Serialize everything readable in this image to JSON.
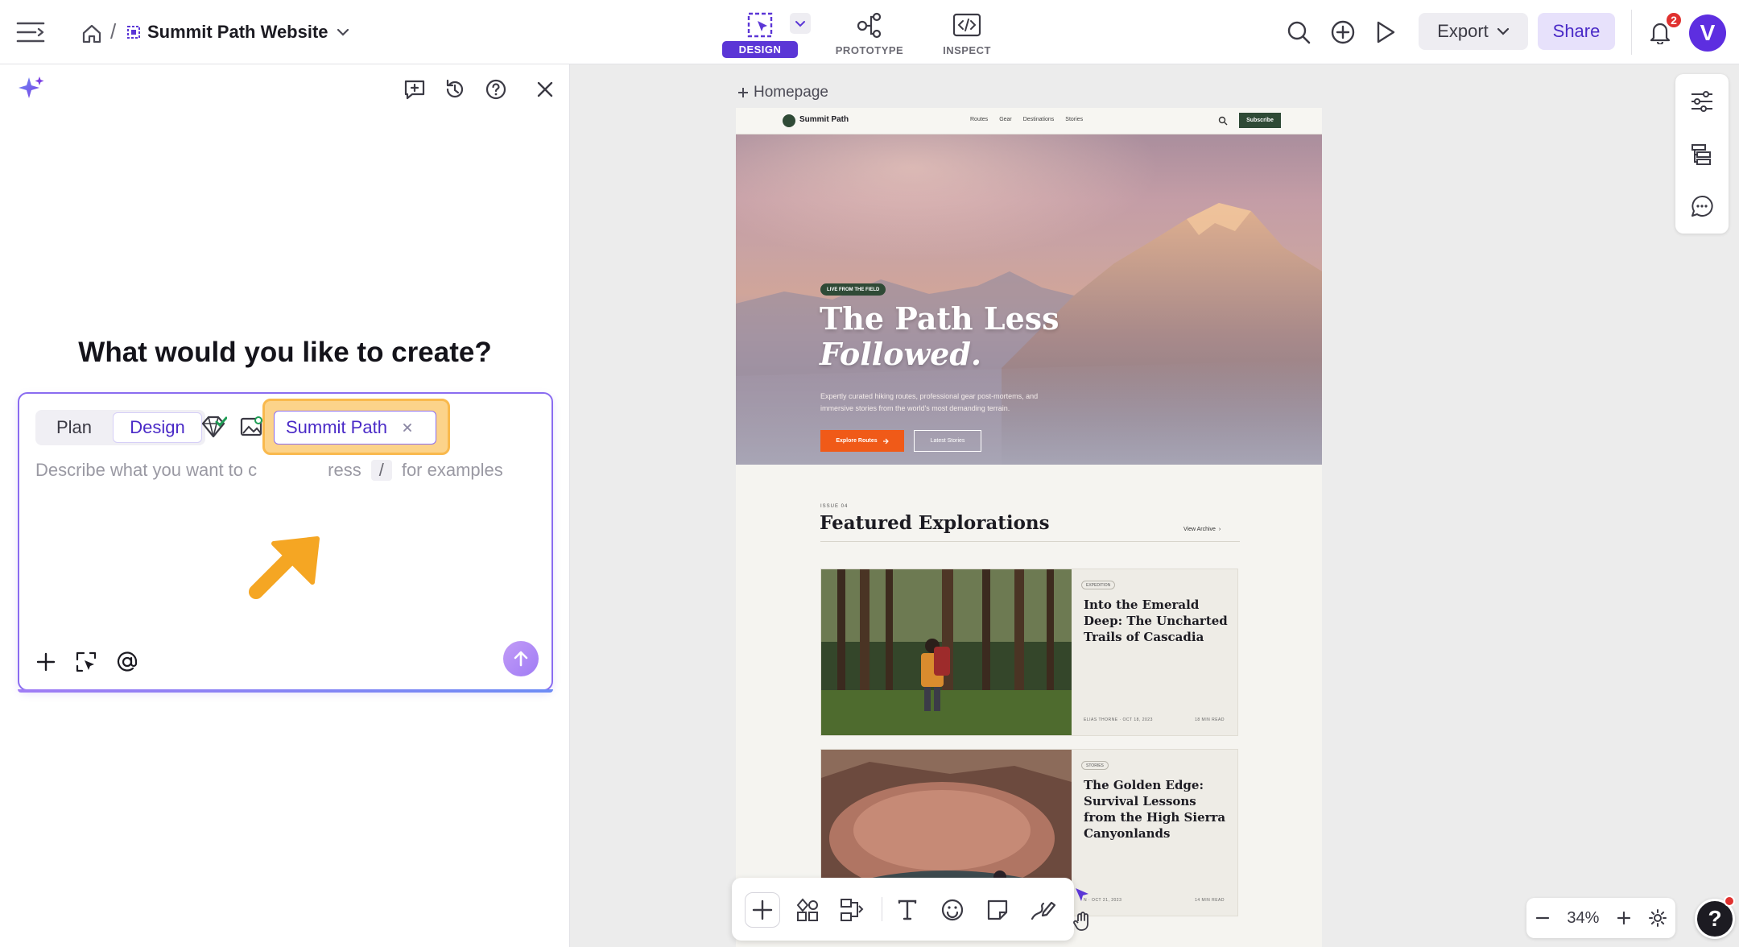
{
  "header": {
    "breadcrumb_sep": "/",
    "project_title": "Summit Path Website",
    "modes": [
      {
        "label": "DESIGN",
        "active": true
      },
      {
        "label": "PROTOTYPE",
        "active": false
      },
      {
        "label": "INSPECT",
        "active": false
      }
    ],
    "export_label": "Export",
    "share_label": "Share",
    "notification_count": "2",
    "avatar_initial": "V"
  },
  "panel": {
    "heading": "What would you like to create?",
    "segments": {
      "plan": "Plan",
      "design": "Design"
    },
    "context_chip": "Summit Path",
    "placeholder_start": "Describe what you want to c",
    "placeholder_mid": "ress",
    "slash_key": "/",
    "placeholder_end": "for examples"
  },
  "canvas": {
    "frame_label": "Homepage",
    "site": {
      "name": "Summit Path",
      "nav_links": [
        "Routes",
        "Gear",
        "Destinations",
        "Stories"
      ],
      "subscribe": "Subscribe",
      "hero_pill": "LIVE FROM THE FIELD",
      "hero_title_line1": "The Path Less",
      "hero_title_line2": "Followed.",
      "hero_sub": "Expertly curated hiking routes, professional gear post-mortems, and immersive stories from the world's most demanding terrain.",
      "cta_primary": "Explore Routes",
      "cta_secondary": "Latest Stories",
      "issue": "ISSUE 04",
      "featured_title": "Featured Explorations",
      "view_archive": "View Archive",
      "cards": [
        {
          "tag": "EXPEDITION",
          "title": "Into the Emerald Deep: The Uncharted Trails of Cascadia",
          "meta": "ELIAS THORNE · OCT 18, 2023",
          "read": "18 MIN READ"
        },
        {
          "tag": "STORIES",
          "title": "The Golden Edge: Survival Lessons from the High Sierra Canyonlands",
          "meta": "N · OCT 21, 2023",
          "read": "14 MIN READ"
        }
      ]
    },
    "zoom": "34%",
    "help": "?"
  }
}
